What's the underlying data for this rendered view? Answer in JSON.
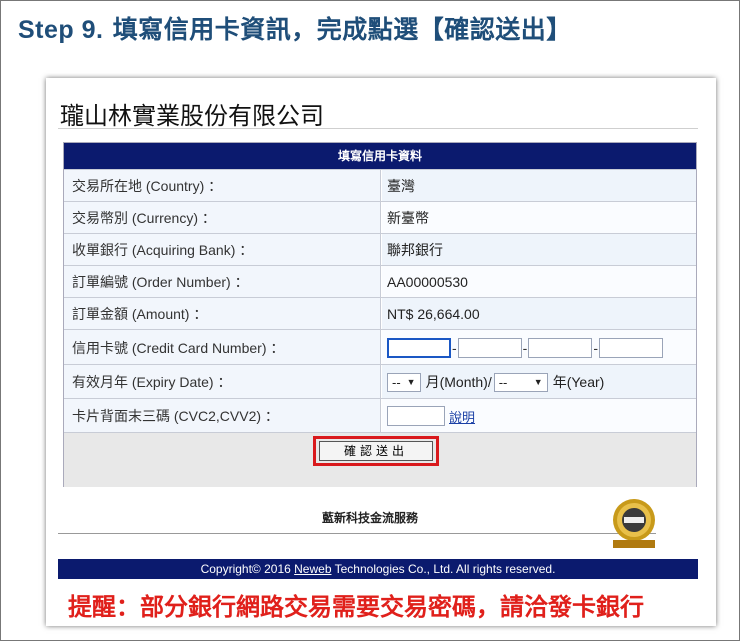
{
  "step": {
    "number": "Step 9.",
    "text": "填寫信用卡資訊，完成點選【確認送出】"
  },
  "company": "瓏山林實業股份有限公司",
  "form": {
    "title": "填寫信用卡資料",
    "country": {
      "label": "交易所在地 (Country) ：",
      "value": "臺灣"
    },
    "currency": {
      "label": "交易幣別 (Currency) ：",
      "value": "新臺幣"
    },
    "bank": {
      "label": "收單銀行 (Acquiring Bank) ：",
      "value": "聯邦銀行"
    },
    "order": {
      "label": "訂單編號 (Order Number) ：",
      "value": "AA00000530"
    },
    "amount": {
      "label": "訂單金額 (Amount) ：",
      "value": "NT$ 26,664.00"
    },
    "card": {
      "label": "信用卡號 (Credit Card Number) ：",
      "separator": "-"
    },
    "expiry": {
      "label": "有效月年 (Expiry Date) ：",
      "month_value": "--",
      "month_unit": "月(Month)/",
      "year_value": "--",
      "year_unit": "年(Year)"
    },
    "cvc": {
      "label": "卡片背面末三碼 (CVC2,CVV2) ：",
      "help_link": "說明"
    },
    "submit": "確認送出"
  },
  "service": "藍新科技金流服務",
  "copyright": {
    "prefix": "Copyright© 2016 ",
    "brand": "Neweb",
    "suffix": " Technologies Co., Ltd. All rights reserved."
  },
  "reminder": "提醒：部分銀行網路交易需要交易密碼，請洽發卡銀行",
  "colors": {
    "header_navy": "#0b1a6e",
    "highlight_red": "#d9191c",
    "step_blue": "#1f4e79",
    "reminder_red": "#e0201b"
  }
}
